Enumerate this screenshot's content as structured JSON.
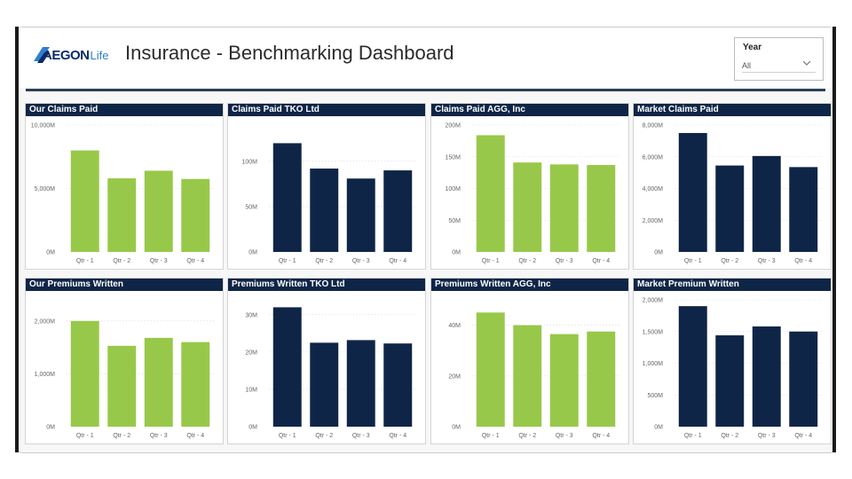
{
  "header": {
    "logo": {
      "bold": "AEGON",
      "light": "Life"
    },
    "title": "Insurance - Benchmarking Dashboard"
  },
  "slicer": {
    "label": "Year",
    "value": "All"
  },
  "colors": {
    "green": "#98c849",
    "navy": "#0f2547",
    "header_bar": "#0f2547",
    "rule": "#2b3f57"
  },
  "chart_data": [
    {
      "type": "bar",
      "title": "Our Claims Paid",
      "categories": [
        "Qtr - 1",
        "Qtr - 2",
        "Qtr - 3",
        "Qtr - 4"
      ],
      "values": [
        8000,
        5800,
        6400,
        5750
      ],
      "ylim": [
        0,
        10000
      ],
      "yticks": [
        0,
        5000,
        10000
      ],
      "ytick_labels": [
        "0M",
        "5,000M",
        "10,000M"
      ],
      "color": "green",
      "grid": true
    },
    {
      "type": "bar",
      "title": "Claims Paid TKO Ltd",
      "categories": [
        "Qtr - 1",
        "Qtr - 2",
        "Qtr - 3",
        "Qtr - 4"
      ],
      "values": [
        120,
        92,
        81,
        90
      ],
      "ylim": [
        0,
        140
      ],
      "yticks": [
        0,
        50,
        100
      ],
      "ytick_labels": [
        "0M",
        "50M",
        "100M"
      ],
      "color": "navy",
      "grid": true
    },
    {
      "type": "bar",
      "title": "Claims Paid AGG, Inc",
      "categories": [
        "Qtr - 1",
        "Qtr - 2",
        "Qtr - 3",
        "Qtr - 4"
      ],
      "values": [
        184,
        141,
        138,
        137
      ],
      "ylim": [
        0,
        200
      ],
      "yticks": [
        0,
        50,
        100,
        150,
        200
      ],
      "ytick_labels": [
        "0M",
        "50M",
        "100M",
        "150M",
        "200M"
      ],
      "color": "green",
      "grid": true
    },
    {
      "type": "bar",
      "title": "Market Claims Paid",
      "categories": [
        "Qtr - 1",
        "Qtr - 2",
        "Qtr - 3",
        "Qtr - 4"
      ],
      "values": [
        7500,
        5450,
        6050,
        5350
      ],
      "ylim": [
        0,
        8000
      ],
      "yticks": [
        0,
        2000,
        4000,
        6000,
        8000
      ],
      "ytick_labels": [
        "0M",
        "2,000M",
        "4,000M",
        "6,000M",
        "8,000M"
      ],
      "color": "navy",
      "grid": true
    },
    {
      "type": "bar",
      "title": "Our Premiums Written",
      "categories": [
        "Qtr - 1",
        "Qtr - 2",
        "Qtr - 3",
        "Qtr - 4"
      ],
      "values": [
        2000,
        1530,
        1680,
        1600
      ],
      "ylim": [
        0,
        2400
      ],
      "yticks": [
        0,
        1000,
        2000
      ],
      "ytick_labels": [
        "0M",
        "1,000M",
        "2,000M"
      ],
      "color": "green",
      "grid": true
    },
    {
      "type": "bar",
      "title": "Premiums Written TKO Ltd",
      "categories": [
        "Qtr - 1",
        "Qtr - 2",
        "Qtr - 3",
        "Qtr - 4"
      ],
      "values": [
        32,
        22.5,
        23.2,
        22.3
      ],
      "ylim": [
        0,
        34
      ],
      "yticks": [
        0,
        10,
        20,
        30
      ],
      "ytick_labels": [
        "0M",
        "10M",
        "20M",
        "30M"
      ],
      "color": "navy",
      "grid": true
    },
    {
      "type": "bar",
      "title": "Premiums Written AGG, Inc",
      "categories": [
        "Qtr - 1",
        "Qtr - 2",
        "Qtr - 3",
        "Qtr - 4"
      ],
      "values": [
        45,
        40,
        36.5,
        37.5
      ],
      "ylim": [
        0,
        50
      ],
      "yticks": [
        0,
        20,
        40
      ],
      "ytick_labels": [
        "0M",
        "20M",
        "40M"
      ],
      "color": "green",
      "grid": true
    },
    {
      "type": "bar",
      "title": "Market Premium Written",
      "categories": [
        "Qtr - 1",
        "Qtr - 2",
        "Qtr - 3",
        "Qtr - 4"
      ],
      "values": [
        1900,
        1440,
        1580,
        1500
      ],
      "ylim": [
        0,
        2000
      ],
      "yticks": [
        0,
        500,
        1000,
        1500,
        2000
      ],
      "ytick_labels": [
        "0M",
        "500M",
        "1,000M",
        "1,500M",
        "2,000M"
      ],
      "color": "navy",
      "grid": true
    }
  ]
}
